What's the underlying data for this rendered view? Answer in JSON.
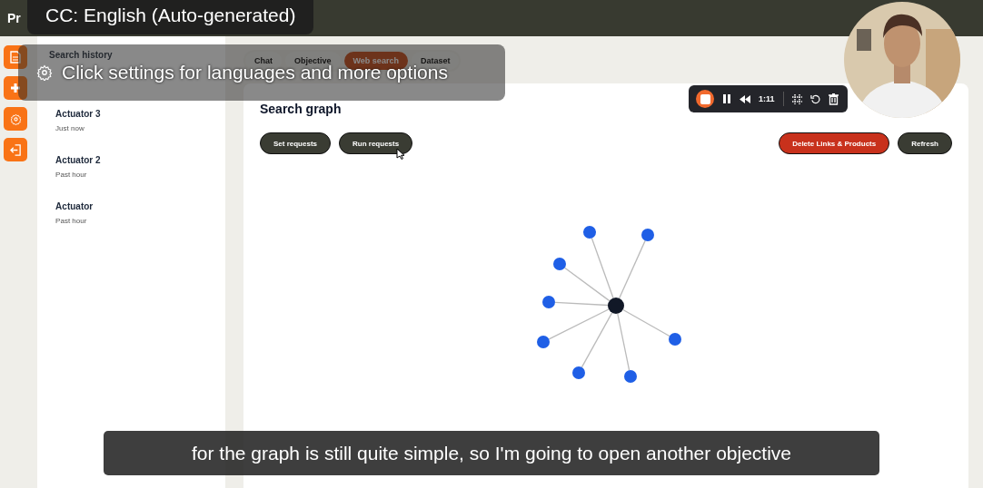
{
  "app": {
    "title": "Pr"
  },
  "rail_buttons": [
    {
      "kind": "document"
    },
    {
      "kind": "plus"
    },
    {
      "kind": "settings"
    },
    {
      "kind": "logout"
    }
  ],
  "sidebar": {
    "heading": "Search history",
    "items": [
      {
        "title": "Actuator 3",
        "time": "Just now"
      },
      {
        "title": "Actuator 2",
        "time": "Past hour"
      },
      {
        "title": "Actuator",
        "time": "Past hour"
      }
    ]
  },
  "tabs": [
    {
      "label": "Chat",
      "selected": false
    },
    {
      "label": "Objective",
      "selected": false
    },
    {
      "label": "Web search",
      "selected": true
    },
    {
      "label": "Dataset",
      "selected": false
    }
  ],
  "card": {
    "title": "Search graph",
    "left_buttons": [
      "Set requests",
      "Run requests"
    ],
    "right_buttons": [
      {
        "label": "Delete Links & Products",
        "kind": "danger"
      },
      {
        "label": "Refresh",
        "kind": "default"
      }
    ]
  },
  "recorder": {
    "time": "1:11"
  },
  "captions": {
    "track": "CC: English (Auto-generated)",
    "hint": "Click settings for languages and more options",
    "subtitle": "for the graph is still quite simple, so I'm going to open another objective"
  }
}
